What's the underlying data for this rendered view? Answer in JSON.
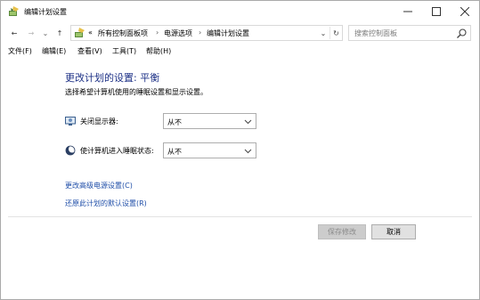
{
  "window": {
    "title": "编辑计划设置",
    "controls": {
      "minimize": "—",
      "maximize": "☐",
      "close": "✕"
    }
  },
  "nav": {
    "back": "←",
    "forward": "→",
    "recent": "⌄",
    "up": "↑",
    "breadcrumb": {
      "overflow": "«",
      "items": [
        "所有控制面板项",
        "电源选项",
        "编辑计划设置"
      ],
      "separator": "›"
    },
    "dropdown": "⌄",
    "refresh": "↻",
    "search_placeholder": "搜索控制面板"
  },
  "menu": {
    "items": [
      "文件(F)",
      "编辑(E)",
      "查看(V)",
      "工具(T)",
      "帮助(H)"
    ]
  },
  "main": {
    "heading": "更改计划的设置: 平衡",
    "subtext": "选择希望计算机使用的睡眠设置和显示设置。",
    "settings": [
      {
        "label": "关闭显示器:",
        "value": "从不",
        "icon": "monitor-icon"
      },
      {
        "label": "使计算机进入睡眠状态:",
        "value": "从不",
        "icon": "moon-icon"
      }
    ],
    "links": {
      "advanced": "更改高级电源设置(C)",
      "restore": "还原此计划的默认设置(R)"
    },
    "buttons": {
      "save": "保存修改",
      "cancel": "取消"
    }
  },
  "colors": {
    "heading": "#1e3287",
    "link": "#1f4ea8",
    "disabled_button_bg": "#cccccc"
  }
}
